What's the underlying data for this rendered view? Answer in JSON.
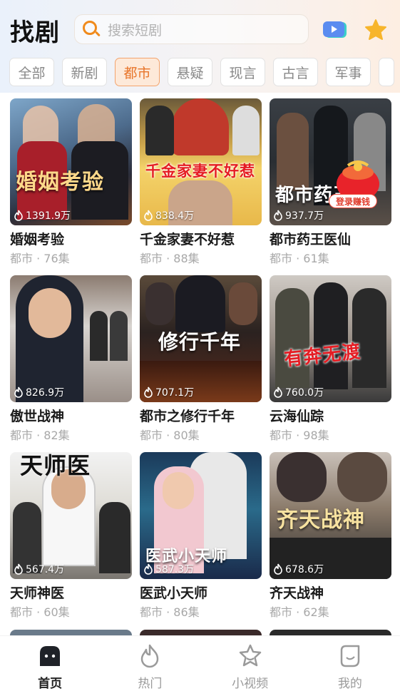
{
  "header": {
    "title": "找剧",
    "search_placeholder": "搜索短剧"
  },
  "tabs": [
    {
      "label": "全部",
      "active": false
    },
    {
      "label": "新剧",
      "active": false
    },
    {
      "label": "都市",
      "active": true
    },
    {
      "label": "悬疑",
      "active": false
    },
    {
      "label": "现言",
      "active": false
    },
    {
      "label": "古言",
      "active": false
    },
    {
      "label": "军事",
      "active": false
    }
  ],
  "promo_badge": "登录赚钱",
  "dramas": [
    {
      "name": "婚姻考验",
      "meta": "都市 · 76集",
      "views": "1391.9万",
      "poster_text": "婚姻考验"
    },
    {
      "name": "千金家妻不好惹",
      "meta": "都市 · 88集",
      "views": "838.4万",
      "poster_text": "千金家妻不好惹"
    },
    {
      "name": "都市药王医仙",
      "meta": "都市 · 61集",
      "views": "937.7万",
      "poster_text": "都市药王"
    },
    {
      "name": "傲世战神",
      "meta": "都市 · 82集",
      "views": "826.9万",
      "poster_text": ""
    },
    {
      "name": "都市之修行千年",
      "meta": "都市 · 80集",
      "views": "707.1万",
      "poster_text": "修行千年"
    },
    {
      "name": "云海仙踪",
      "meta": "都市 · 98集",
      "views": "760.0万",
      "poster_text": "有奔无渡"
    },
    {
      "name": "天师神医",
      "meta": "都市 · 60集",
      "views": "567.4万",
      "poster_text": "天师医"
    },
    {
      "name": "医武小天师",
      "meta": "都市 · 86集",
      "views": "587.3万",
      "poster_text": "医武小天师"
    },
    {
      "name": "齐天战神",
      "meta": "都市 · 62集",
      "views": "678.6万",
      "poster_text": "齐天战神"
    }
  ],
  "bottom_nav": [
    {
      "label": "首页",
      "icon": "home-icon",
      "active": true
    },
    {
      "label": "热门",
      "icon": "flame-icon",
      "active": false
    },
    {
      "label": "小视频",
      "icon": "star-video-icon",
      "active": false
    },
    {
      "label": "我的",
      "icon": "profile-icon",
      "active": false
    }
  ]
}
